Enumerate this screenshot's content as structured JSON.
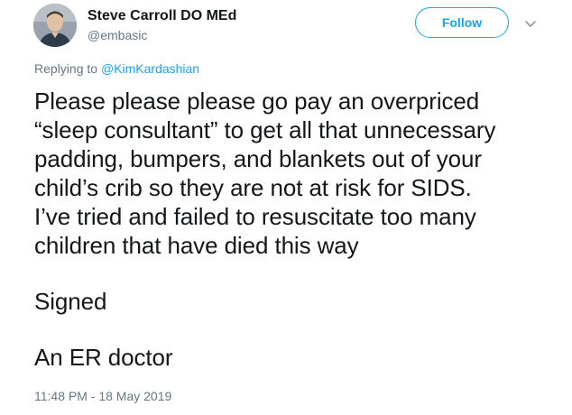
{
  "author": {
    "display_name": "Steve Carroll DO MEd",
    "username": "@embasic"
  },
  "actions": {
    "follow_label": "Follow",
    "more_icon": "chevron-down-icon"
  },
  "reply": {
    "prefix": "Replying to",
    "mention": "@KimKardashian"
  },
  "tweet": {
    "paragraph_1": "Please please please go pay an overpriced\n“sleep consultant” to get all that unnecessary\npadding, bumpers, and blankets out of your\nchild’s crib so they are not at risk for SIDS.\nI’ve tried and failed to resuscitate too many\nchildren that have died this way",
    "paragraph_2": "Signed",
    "paragraph_3": "An ER doctor"
  },
  "meta": {
    "timestamp": "11:48 PM - 18 May 2019"
  },
  "colors": {
    "accent": "#1da1f2",
    "secondary_text": "#657786",
    "primary_text": "#14171a"
  }
}
